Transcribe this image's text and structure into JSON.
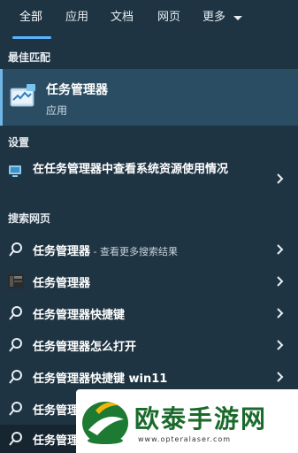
{
  "tabs": [
    {
      "label": "全部"
    },
    {
      "label": "应用"
    },
    {
      "label": "文档"
    },
    {
      "label": "网页"
    },
    {
      "label": "更多"
    }
  ],
  "best_match": {
    "section_title": "最佳匹配",
    "title": "任务管理器",
    "subtitle": "应用",
    "icon": "task-manager-icon"
  },
  "settings": {
    "section_title": "设置",
    "item": "在任务管理器中查看系统资源使用情况",
    "icon": "monitor-icon"
  },
  "web": {
    "section_title": "搜索网页",
    "items": [
      {
        "label": "任务管理器",
        "hint": " - 查看更多搜索结果",
        "icon": "search-icon"
      },
      {
        "label": "任务管理器",
        "hint": "",
        "icon": "app-thumbnail-icon"
      },
      {
        "label": "任务管理器快捷键",
        "hint": "",
        "icon": "search-icon"
      },
      {
        "label": "任务管理器怎么打开",
        "hint": "",
        "icon": "search-icon"
      },
      {
        "label": "任务管理器快捷键 win11",
        "hint": "",
        "icon": "search-icon"
      },
      {
        "label": "任务管理",
        "hint": "",
        "icon": "search-icon"
      }
    ]
  },
  "search": {
    "value": "任务管理"
  },
  "watermark": {
    "title": "欧泰手游网",
    "url": "www.opteralaser.com"
  },
  "colors": {
    "background": "#1f3443",
    "selected": "#2a4d63",
    "accent": "#5ab4ff"
  }
}
